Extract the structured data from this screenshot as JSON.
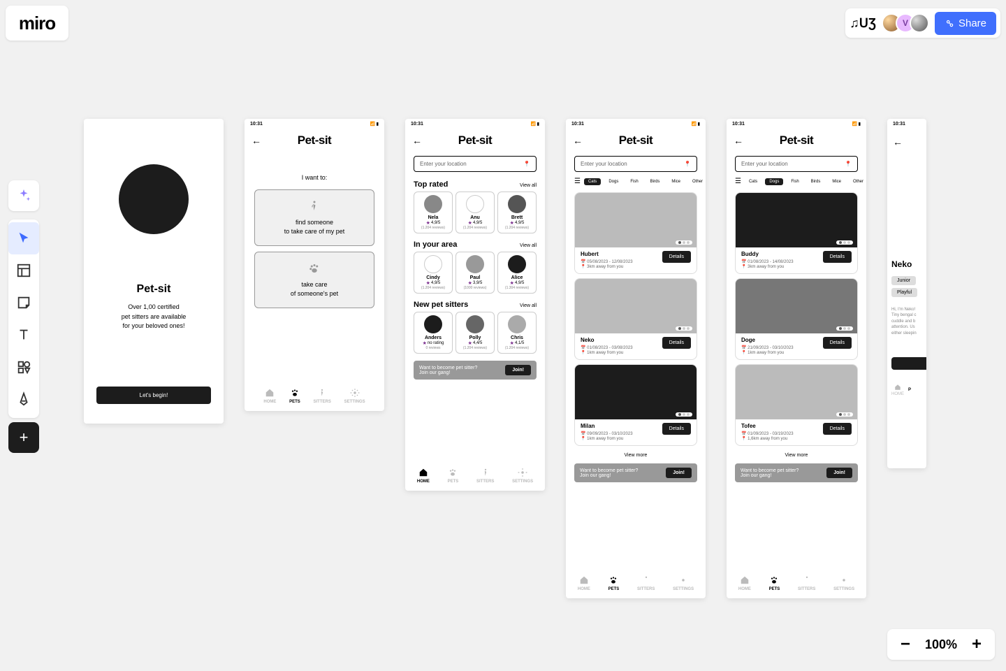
{
  "app": {
    "logo": "miro"
  },
  "topbar": {
    "reactions": "♫ᑌƷ",
    "user_initial": "V",
    "share_label": "Share"
  },
  "toolbar_tools": [
    "ai-sparkle",
    "cursor",
    "template",
    "sticky",
    "text",
    "shapes",
    "pen"
  ],
  "zoom": {
    "value": "100%",
    "minus": "−",
    "plus": "+"
  },
  "app_title": "Pet-sit",
  "status_time": "10:31",
  "frame1": {
    "title": "Pet-sit",
    "tagline": "Over 1,00 certified\npet sitters are available\nfor your beloved ones!",
    "cta": "Let's begin!"
  },
  "frame2": {
    "prompt": "I want to:",
    "option1": "find someone\nto take care of my pet",
    "option2": "take care\nof someone's pet"
  },
  "nav": {
    "home": "HOME",
    "pets": "PETS",
    "sitters": "SITTERS",
    "settings": "SETTINGS"
  },
  "search_placeholder": "Enter your location",
  "view_all": "View all",
  "frame3": {
    "sec1": "Top rated",
    "sec2": "In your area",
    "sec3": "New pet sitters",
    "top": [
      {
        "name": "Nela",
        "rating": "4,9/5",
        "reviews": "(1.204 reviews)",
        "color": "#888"
      },
      {
        "name": "Anu",
        "rating": "4,9/5",
        "reviews": "(1.204 reviews)",
        "color": "#fff"
      },
      {
        "name": "Brett",
        "rating": "4,9/5",
        "reviews": "(1.204 reviews)",
        "color": "#555"
      }
    ],
    "area": [
      {
        "name": "Cindy",
        "rating": "4,9/5",
        "reviews": "(1.204 reviews)",
        "color": "#fff"
      },
      {
        "name": "Paul",
        "rating": "3,9/5",
        "reviews": "(1000 reviews)",
        "color": "#999"
      },
      {
        "name": "Alice",
        "rating": "4,9/5",
        "reviews": "(1.304 reviews)",
        "color": "#1c1c1c"
      }
    ],
    "new": [
      {
        "name": "Anders",
        "rating": "no rating",
        "reviews": "0 reviews",
        "color": "#1c1c1c"
      },
      {
        "name": "Polly",
        "rating": "4,4/5",
        "reviews": "(1.204 reviews)",
        "color": "#666"
      },
      {
        "name": "Chris",
        "rating": "4,1/5",
        "reviews": "(1.204 reviews)",
        "color": "#aaa"
      }
    ]
  },
  "promo": {
    "line1": "Want to become pet sitter?",
    "line2": "Join our gang!",
    "btn": "Join!"
  },
  "filters": [
    "Cats",
    "Dogs",
    "Fish",
    "Birds",
    "Mice",
    "Other"
  ],
  "frame4_active": "Cats",
  "frame5_active": "Dogs",
  "details_btn": "Details",
  "view_more": "View more",
  "frame4_pets": [
    {
      "name": "Hubert",
      "dates": "05/08/2023 - 12/08/2023",
      "dist": "3km away from you",
      "img": "#bbb"
    },
    {
      "name": "Neko",
      "dates": "01/08/2023 - 03/08/2023",
      "dist": "1km away from you",
      "img": "#bbb"
    },
    {
      "name": "Milan",
      "dates": "09/09/2023 - 03/10/2023",
      "dist": "1km away from you",
      "img": "#1c1c1c"
    }
  ],
  "frame5_pets": [
    {
      "name": "Buddy",
      "dates": "01/08/2023 - 14/08/2023",
      "dist": "3km away from you",
      "img": "#1c1c1c"
    },
    {
      "name": "Doge",
      "dates": "21/09/2023 - 03/10/2023",
      "dist": "1km away from you",
      "img": "#777"
    },
    {
      "name": "Tofee",
      "dates": "01/09/2023 - 03/19/2023",
      "dist": "1,6km away from you",
      "img": "#bbb"
    }
  ],
  "frame6": {
    "name": "Neko",
    "tags": [
      "Junior",
      "Playful"
    ],
    "desc": "Hi, I'm Neko!\nTiny bengal c\ncuddle and b\nattention. Us\neither sleepin",
    "home": "HOME",
    "pets_initial": "P"
  }
}
